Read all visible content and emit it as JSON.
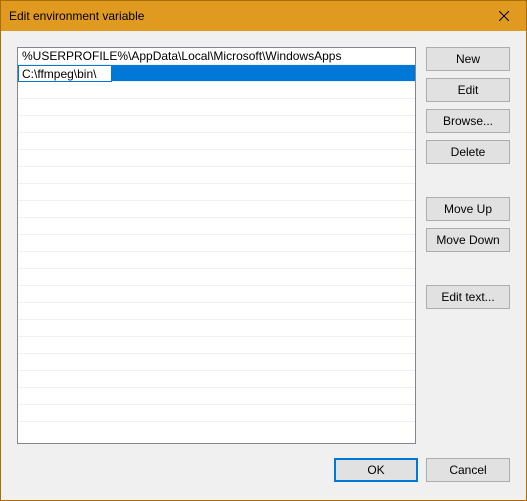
{
  "window": {
    "title": "Edit environment variable"
  },
  "list": {
    "items": [
      "%USERPROFILE%\\AppData\\Local\\Microsoft\\WindowsApps"
    ],
    "editing_value": "C:\\ffmpeg\\bin\\"
  },
  "buttons": {
    "new": "New",
    "edit": "Edit",
    "browse": "Browse...",
    "delete": "Delete",
    "move_up": "Move Up",
    "move_down": "Move Down",
    "edit_text": "Edit text..."
  },
  "footer": {
    "ok": "OK",
    "cancel": "Cancel"
  }
}
